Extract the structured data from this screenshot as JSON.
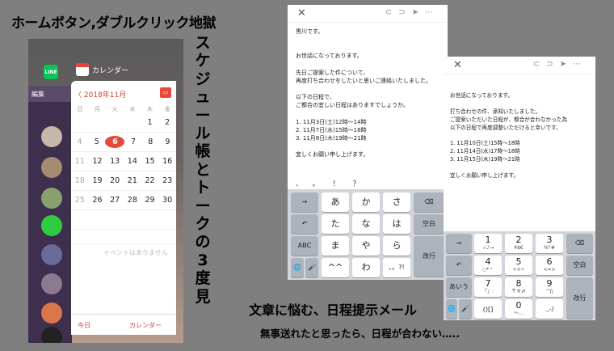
{
  "headline": "ホームボタン,ダブルクリック地獄",
  "vertical_text": [
    "ス",
    "ケ",
    "ジ",
    "ュ",
    "ー",
    "ル",
    "帳",
    "と",
    "ト",
    "ー",
    "ク",
    "の",
    "3",
    "度",
    "見"
  ],
  "switcher": {
    "line_label": "編集",
    "line_icon_label": "LINE",
    "calendar_app_name": "カレンダー"
  },
  "calendar": {
    "month_back": "〈 2018年11月",
    "weekdays": [
      "日",
      "月",
      "火",
      "水",
      "木",
      "金",
      "土"
    ],
    "rows": [
      [
        "",
        "",
        "",
        "",
        "1",
        "2",
        ""
      ],
      [
        "4",
        "5",
        "6",
        "7",
        "8",
        "9",
        ""
      ],
      [
        "11",
        "12",
        "13",
        "14",
        "15",
        "16",
        ""
      ],
      [
        "18",
        "19",
        "20",
        "21",
        "22",
        "23",
        ""
      ],
      [
        "25",
        "26",
        "27",
        "28",
        "29",
        "30",
        ""
      ]
    ],
    "today": "6",
    "no_events": "イベントはありません",
    "footer_today": "今日",
    "footer_calendars": "カレンダー"
  },
  "mail1": {
    "close": "✕",
    "body": "黒川です。\n\n\nお世話になっております。\n\n先日ご提案した件について、\n再度打ち合わせをしたいと思いご連絡いたしました。\n\n以下の日程で、\nご都合の宜しい日程はありますでしょうか。\n\n1. 11月3日(土)12時～14時\n2. 11月7日(水)15時～18時\n3. 11月8日(木)19時～21時\n\n宜しくお願い申し上げます。",
    "punct": [
      "、",
      "。",
      "！",
      "？"
    ]
  },
  "kana_keyboard": {
    "keys": [
      "→",
      "あ",
      "か",
      "さ",
      "⌫",
      "↶",
      "た",
      "な",
      "は",
      "空白",
      "ABC",
      "ま",
      "や",
      "ら",
      "改行",
      "🌐",
      "🎤",
      "^^",
      "わ",
      "、。?!"
    ]
  },
  "mail2": {
    "close": "✕",
    "body": "お世話になっております。\n\n打ち合わせの件、承知いたしました。\nご提案いただいた日程が、都合が合わなかった為\n以下の日程で再度調整いただけると幸いです。\n\n1. 11月10日(土)15時～18時\n2. 11月14日(水)17時～18時\n3. 11月15日(木)19時～21時\n\n宜しくお願い申し上げます。"
  },
  "num_keyboard": {
    "rows": [
      [
        {
          "n": "1",
          "s": "☆♪→"
        },
        {
          "n": "2",
          "s": "¥$€"
        },
        {
          "n": "3",
          "s": "%°#"
        }
      ],
      [
        {
          "n": "4",
          "s": "○*・"
        },
        {
          "n": "5",
          "s": "+×÷"
        },
        {
          "n": "6",
          "s": "<=>"
        }
      ],
      [
        {
          "n": "7",
          "s": "「」:"
        },
        {
          "n": "8",
          "s": "〒々〆"
        },
        {
          "n": "9",
          "s": "^|\\"
        }
      ],
      [
        {
          "n": "()[]",
          "s": ""
        },
        {
          "n": "0",
          "s": "〜…"
        },
        {
          "n": ".,-/",
          "s": ""
        }
      ]
    ],
    "left_keys": [
      "→",
      "↶",
      "あいう",
      "🌐",
      "🎤"
    ],
    "right_keys": [
      "⌫",
      "空白",
      "改行"
    ]
  },
  "caption_main": "文章に悩む、日程提示メール",
  "caption_sub": "無事送れたと思ったら、日程が合わない…..",
  "colors": {
    "bg": "#7f7f7f",
    "accent_red": "#e54b3c",
    "line_green": "#06c755"
  }
}
